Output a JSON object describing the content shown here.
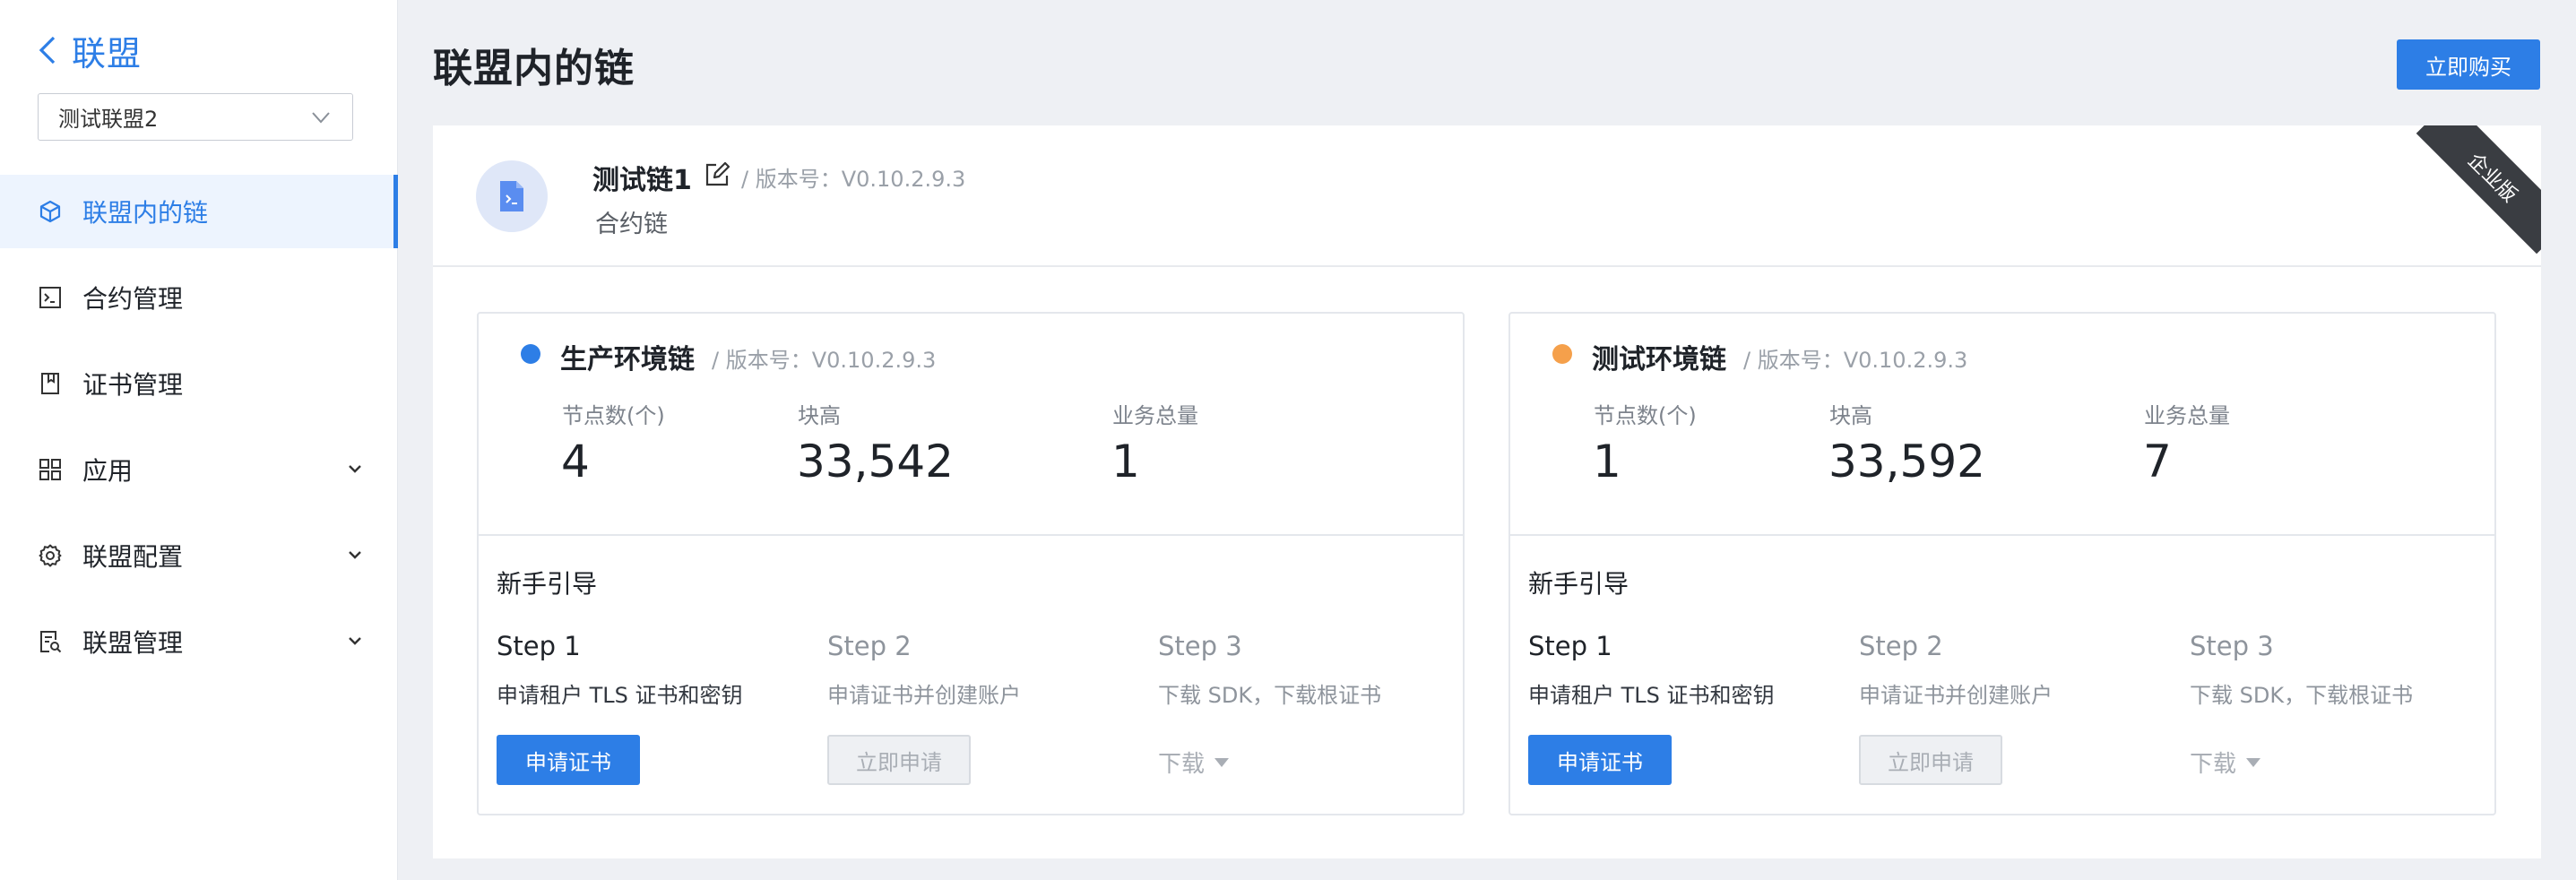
{
  "sidebar": {
    "back_label": "联盟",
    "alliance_select": {
      "value": "测试联盟2"
    },
    "items": [
      {
        "label": "联盟内的链",
        "icon": "cube-icon",
        "active": true
      },
      {
        "label": "合约管理",
        "icon": "terminal-icon"
      },
      {
        "label": "证书管理",
        "icon": "book-icon"
      },
      {
        "label": "应用",
        "icon": "apps-grid-icon",
        "expandable": true
      },
      {
        "label": "联盟配置",
        "icon": "gear-icon",
        "expandable": true
      },
      {
        "label": "联盟管理",
        "icon": "list-search-icon",
        "expandable": true
      }
    ]
  },
  "header": {
    "title": "联盟内的链",
    "buy_label": "立即购买"
  },
  "chain": {
    "name": "测试链1",
    "version": "/ 版本号：V0.10.2.9.3",
    "type": "合约链",
    "badge": "企业版"
  },
  "environments": [
    {
      "name": "生产环境链",
      "version": "/ 版本号：V0.10.2.9.3",
      "dot_color": "#2d7ee6",
      "stats": [
        {
          "label": "节点数(个)",
          "value": "4"
        },
        {
          "label": "块高",
          "value": "33,542"
        },
        {
          "label": "业务总量",
          "value": "1"
        }
      ]
    },
    {
      "name": "测试环境链",
      "version": "/ 版本号：V0.10.2.9.3",
      "dot_color": "#f5a04b",
      "stats": [
        {
          "label": "节点数(个)",
          "value": "1"
        },
        {
          "label": "块高",
          "value": "33,592"
        },
        {
          "label": "业务总量",
          "value": "7"
        }
      ]
    }
  ],
  "guide": {
    "title": "新手引导",
    "steps": [
      {
        "title": "Step 1",
        "desc": "申请租户 TLS 证书和密钥",
        "action": "申请证书"
      },
      {
        "title": "Step 2",
        "desc": "申请证书并创建账户",
        "action": "立即申请"
      },
      {
        "title": "Step 3",
        "desc": "下载 SDK，下载根证书",
        "action": "下载"
      }
    ]
  },
  "colors": {
    "accent": "#2d7ee6",
    "prod_dot": "#2d7ee6",
    "test_dot": "#f5a04b"
  }
}
